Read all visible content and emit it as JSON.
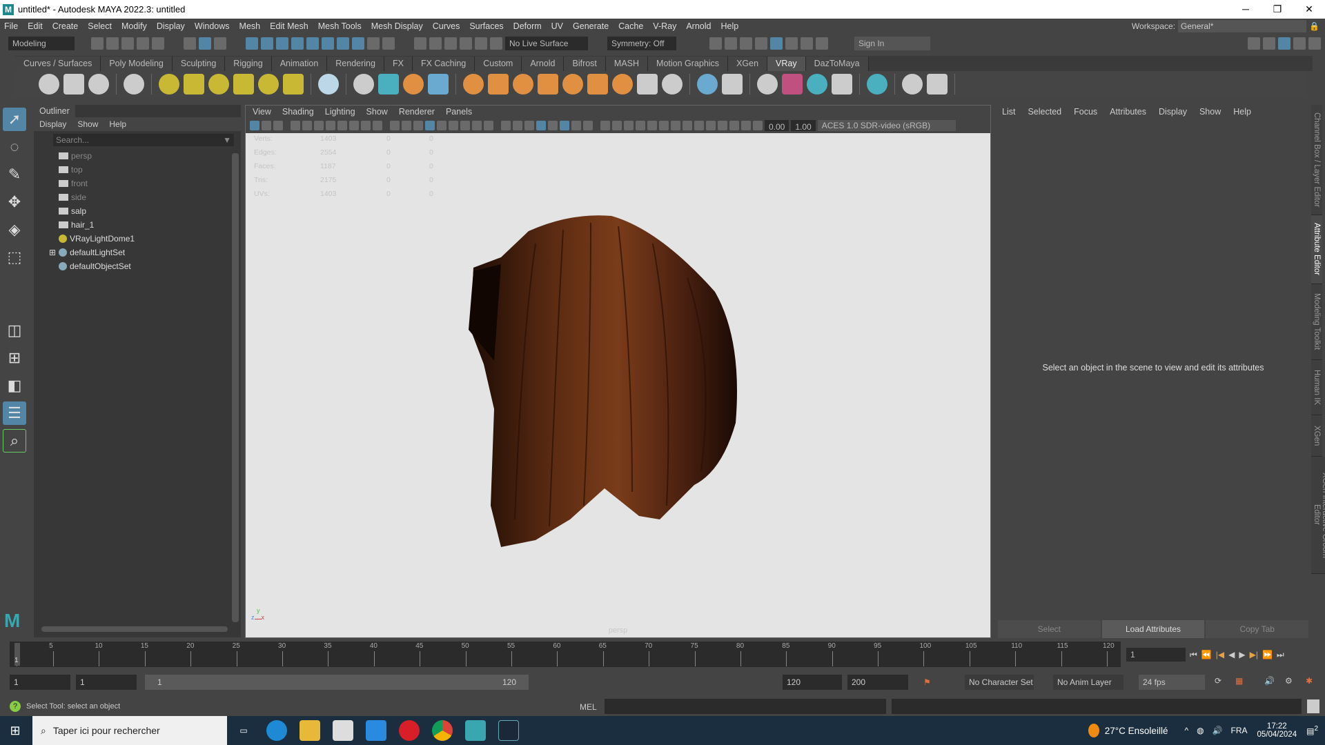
{
  "window": {
    "title": "untitled* - Autodesk MAYA 2022.3: untitled",
    "logo": "M",
    "minimize": "─",
    "maximize": "❐",
    "close": "✕"
  },
  "menubar": [
    "File",
    "Edit",
    "Create",
    "Select",
    "Modify",
    "Display",
    "Windows",
    "Mesh",
    "Edit Mesh",
    "Mesh Tools",
    "Mesh Display",
    "Curves",
    "Surfaces",
    "Deform",
    "UV",
    "Generate",
    "Cache",
    "V-Ray",
    "Arnold",
    "Help"
  ],
  "workspace": {
    "label": "Workspace:",
    "value": "General*"
  },
  "statusline": {
    "mode": "Modeling",
    "live_surface": "No Live Surface",
    "symmetry": "Symmetry: Off",
    "sign_in": "Sign In"
  },
  "shelf_tabs": [
    "Curves / Surfaces",
    "Poly Modeling",
    "Sculpting",
    "Rigging",
    "Animation",
    "Rendering",
    "FX",
    "FX Caching",
    "Custom",
    "Arnold",
    "Bifrost",
    "MASH",
    "Motion Graphics",
    "XGen",
    "VRay",
    "DazToMaya"
  ],
  "shelf_active": "VRay",
  "shelf_icons": [
    [
      "#ccc",
      "#ccc",
      "#ccc"
    ],
    [
      "#ccc"
    ],
    [
      "#c8b834",
      "#c8b834",
      "#c8b834",
      "#c8b834",
      "#c8b834",
      "#c8b834"
    ],
    [
      "#bcd8e8"
    ],
    [
      "#ccc",
      "#4ab0c0",
      "#e09040",
      "#6aaad0"
    ],
    [
      "#e09040",
      "#e09040",
      "#e09040",
      "#e09040",
      "#e09040",
      "#e09040",
      "#e09040",
      "#ccc",
      "#ccc"
    ],
    [
      "#6aaad0",
      "#ccc"
    ],
    [
      "#ccc",
      "#c05080",
      "#4ab0c0",
      "#ccc"
    ],
    [
      "#4ab0c0"
    ],
    [
      "#ccc",
      "#ccc"
    ]
  ],
  "outliner": {
    "tab": "Outliner",
    "menu": [
      "Display",
      "Show",
      "Help"
    ],
    "search_placeholder": "Search...",
    "items": [
      {
        "label": "persp",
        "type": "camera",
        "dim": true
      },
      {
        "label": "top",
        "type": "camera",
        "dim": true
      },
      {
        "label": "front",
        "type": "camera",
        "dim": true
      },
      {
        "label": "side",
        "type": "camera",
        "dim": true
      },
      {
        "label": "salp",
        "type": "mesh"
      },
      {
        "label": "hair_1",
        "type": "mesh"
      },
      {
        "label": "VRayLightDome1",
        "type": "light"
      },
      {
        "label": "defaultLightSet",
        "type": "set",
        "expand": "⊞"
      },
      {
        "label": "defaultObjectSet",
        "type": "set"
      }
    ]
  },
  "viewport": {
    "menu": [
      "View",
      "Shading",
      "Lighting",
      "Show",
      "Renderer",
      "Panels"
    ],
    "exposure": "0.00",
    "gamma": "1.00",
    "color_space": "ACES 1.0 SDR-video (sRGB)",
    "camera_label": "persp",
    "hud": [
      [
        "Verts:",
        "1403",
        "0",
        "0"
      ],
      [
        "Edges:",
        "2554",
        "0",
        "0"
      ],
      [
        "Faces:",
        "1187",
        "0",
        "0"
      ],
      [
        "Tris:",
        "2175",
        "0",
        "0"
      ],
      [
        "UVs:",
        "1403",
        "0",
        "0"
      ]
    ],
    "axis_y": "y",
    "axis_z": "z",
    "axis_x": "x"
  },
  "attribute_editor": {
    "menu": [
      "List",
      "Selected",
      "Focus",
      "Attributes",
      "Display",
      "Show",
      "Help"
    ],
    "message": "Select an object in the scene to view and edit its attributes",
    "buttons": [
      "Select",
      "Load Attributes",
      "Copy Tab"
    ]
  },
  "side_tabs": [
    "Channel Box / Layer Editor",
    "Attribute Editor",
    "Modeling Toolkit",
    "Human IK",
    "XGen",
    "XGen Interactive Groom Editor"
  ],
  "timeline": {
    "start": 1,
    "end": 120,
    "current": 1,
    "labels": [
      "5",
      "10",
      "15",
      "20",
      "25",
      "30",
      "35",
      "40",
      "45",
      "50",
      "55",
      "60",
      "65",
      "70",
      "75",
      "80",
      "85",
      "90",
      "95",
      "100",
      "105",
      "110",
      "115",
      "120"
    ],
    "current_field": "1",
    "start_marker": "1"
  },
  "range": {
    "start": "1",
    "playback_start": "1",
    "slider_start": "1",
    "slider_end": "120",
    "playback_end": "120",
    "end": "200",
    "character_set": "No Character Set",
    "anim_layer": "No Anim Layer",
    "fps": "24 fps"
  },
  "commandline": {
    "help": "Select Tool: select an object",
    "lang": "MEL"
  },
  "taskbar": {
    "search": "Taper ici pour rechercher",
    "weather": "27°C  Ensoleillé",
    "lang": "FRA",
    "time": "17:22",
    "date": "05/04/2024",
    "notifications": "2"
  }
}
